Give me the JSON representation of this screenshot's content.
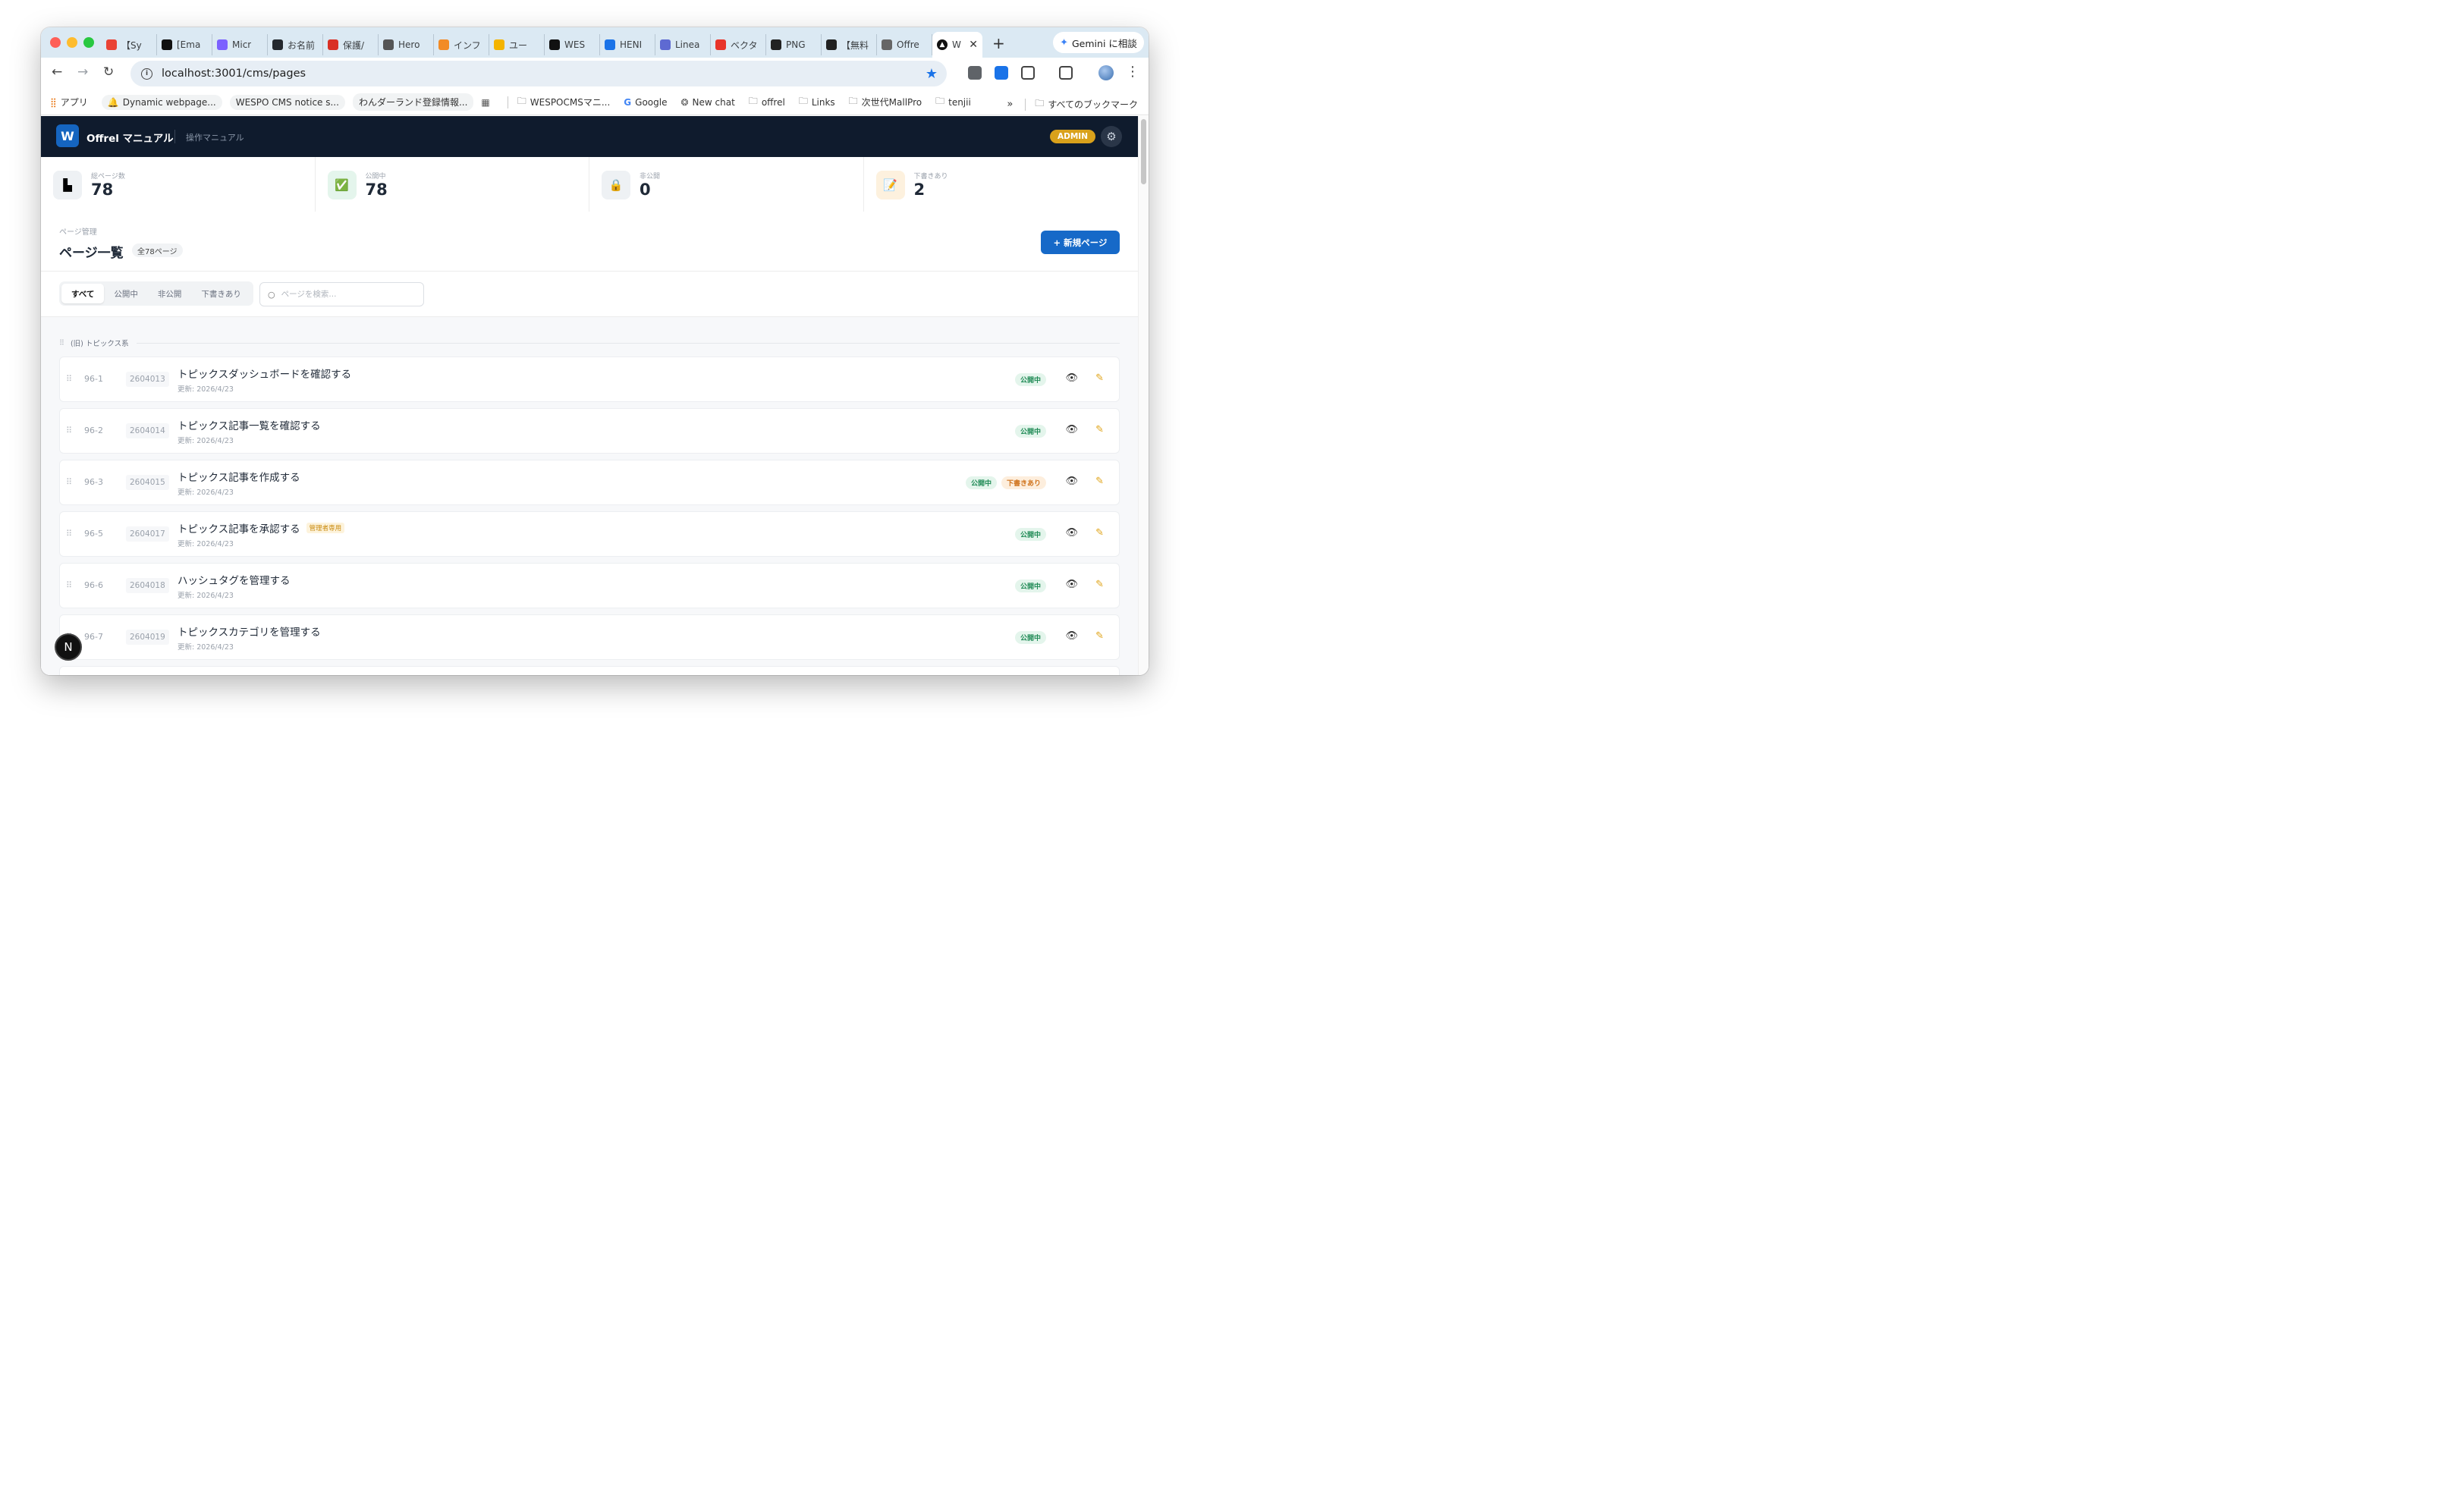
{
  "browser": {
    "tabs": [
      {
        "label": "【Sy",
        "icon": "gmail-icon",
        "color": "#ea4335"
      },
      {
        "label": "[Ema",
        "icon": "x-logo-icon",
        "color": "#111111"
      },
      {
        "label": "Micr",
        "icon": "copilot-icon",
        "color": "#7b61ff"
      },
      {
        "label": "お名前",
        "icon": "github-icon",
        "color": "#24292f"
      },
      {
        "label": "保護/",
        "icon": "shield-app-icon",
        "color": "#d93025"
      },
      {
        "label": "Hero",
        "icon": "openai-icon",
        "color": "#555555"
      },
      {
        "label": "インフ",
        "icon": "app-orange-icon",
        "color": "#f28b25"
      },
      {
        "label": "ユー",
        "icon": "analytics-icon",
        "color": "#f4b400"
      },
      {
        "label": "WES",
        "icon": "triangle-app-icon",
        "color": "#111111"
      },
      {
        "label": "HENI",
        "icon": "henn-icon",
        "color": "#1a73e8"
      },
      {
        "label": "Linea",
        "icon": "linear-icon",
        "color": "#5e6ad2"
      },
      {
        "label": "ベクタ",
        "icon": "adobe-icon",
        "color": "#e8342a"
      },
      {
        "label": "PNG",
        "icon": "app-dark-icon",
        "color": "#222222"
      },
      {
        "label": "【無料",
        "icon": "app-dark-icon",
        "color": "#222222"
      },
      {
        "label": "Offre",
        "icon": "globe-icon",
        "color": "#666666"
      }
    ],
    "active_tab": {
      "label": "W",
      "icon": "triangle-app-icon"
    },
    "gemini_label": "Gemini に相談",
    "url": "localhost:3001/cms/pages",
    "bookmarks": [
      {
        "label": "アプリ",
        "icon": "apps-grid-icon",
        "chip": false
      },
      {
        "label": "Dynamic webpage...",
        "icon": "bell-icon",
        "chip": true
      },
      {
        "label": "WESPO CMS notice s...",
        "icon": "",
        "chip": true
      },
      {
        "label": "わんダーランド登録情報...",
        "icon": "",
        "chip": true
      },
      {
        "label": "",
        "icon": "grid-icon",
        "chip": false
      },
      {
        "label": "WESPOCMSマニ...",
        "icon": "folder-icon",
        "chip": false
      },
      {
        "label": "Google",
        "icon": "google-icon",
        "chip": false
      },
      {
        "label": "New chat",
        "icon": "openai-icon",
        "chip": false
      },
      {
        "label": "offrel",
        "icon": "folder-icon",
        "chip": false
      },
      {
        "label": "Links",
        "icon": "folder-icon",
        "chip": false
      },
      {
        "label": "次世代MallPro",
        "icon": "folder-icon",
        "chip": false
      },
      {
        "label": "tenjii",
        "icon": "folder-icon",
        "chip": false
      }
    ],
    "all_bookmarks_label": "すべてのブックマーク"
  },
  "app": {
    "logo_letter": "W",
    "title": "Offrel マニュアル",
    "subtitle": "操作マニュアル",
    "admin_badge": "ADMIN",
    "stats": [
      {
        "label": "総ページ数",
        "value": "78",
        "icon": "document-icon",
        "icon_bg": "#eef1f4",
        "glyph": "▙"
      },
      {
        "label": "公開中",
        "value": "78",
        "icon": "check-icon",
        "icon_bg": "#e4f5ec",
        "glyph": "✅"
      },
      {
        "label": "非公開",
        "value": "0",
        "icon": "lock-icon",
        "icon_bg": "#eef1f4",
        "glyph": "🔒"
      },
      {
        "label": "下書きあり",
        "value": "2",
        "icon": "memo-icon",
        "icon_bg": "#fdf1de",
        "glyph": "📝"
      }
    ],
    "breadcrumb": "ページ管理",
    "page_title": "ページ一覧",
    "count_pill": "全78ページ",
    "new_page_button": "+ 新規ページ",
    "filter_tabs": [
      "すべて",
      "公開中",
      "非公開",
      "下書きあり"
    ],
    "search_placeholder": "ページを検索...",
    "group_name": "(旧) トピックス系",
    "rows": [
      {
        "num": "96-1",
        "code": "2604013",
        "title": "トピックスダッシュボードを確認する",
        "updated": "更新: 2026/4/23",
        "admin_only": "",
        "published": "公開中",
        "draft": ""
      },
      {
        "num": "96-2",
        "code": "2604014",
        "title": "トピックス記事一覧を確認する",
        "updated": "更新: 2026/4/23",
        "admin_only": "",
        "published": "公開中",
        "draft": ""
      },
      {
        "num": "96-3",
        "code": "2604015",
        "title": "トピックス記事を作成する",
        "updated": "更新: 2026/4/23",
        "admin_only": "",
        "published": "公開中",
        "draft": "下書きあり"
      },
      {
        "num": "96-5",
        "code": "2604017",
        "title": "トピックス記事を承認する",
        "updated": "更新: 2026/4/23",
        "admin_only": "管理者専用",
        "published": "公開中",
        "draft": ""
      },
      {
        "num": "96-6",
        "code": "2604018",
        "title": "ハッシュタグを管理する",
        "updated": "更新: 2026/4/23",
        "admin_only": "",
        "published": "公開中",
        "draft": ""
      },
      {
        "num": "96-7",
        "code": "2604019",
        "title": "トピックスカテゴリを管理する",
        "updated": "更新: 2026/4/23",
        "admin_only": "",
        "published": "公開中",
        "draft": ""
      }
    ],
    "floating_button": "N"
  }
}
